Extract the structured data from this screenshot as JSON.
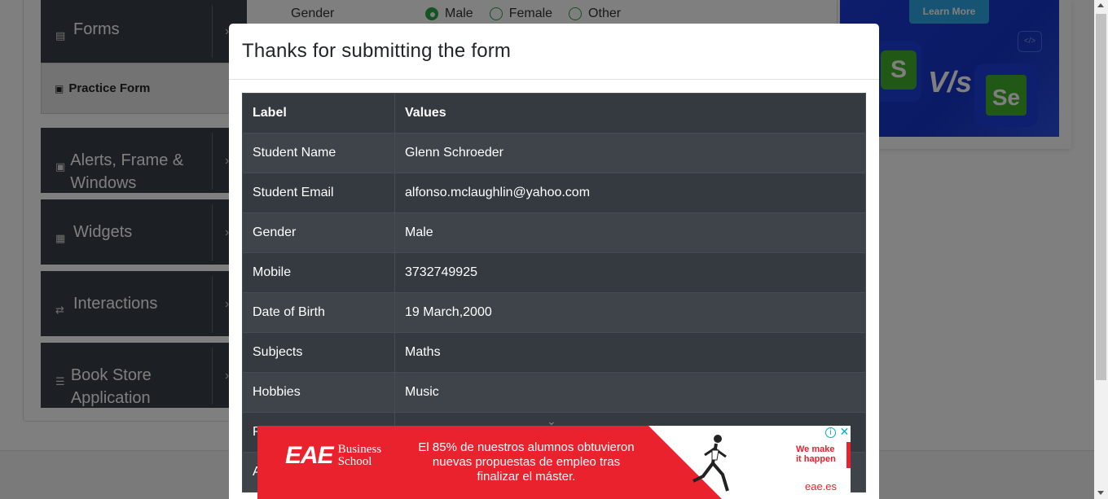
{
  "sidebar": {
    "groups": [
      {
        "label": "Forms",
        "icon": "document-icon"
      },
      {
        "label": "Alerts, Frame & Windows",
        "icon": "window-icon"
      },
      {
        "label": "Widgets",
        "icon": "widgets-icon"
      },
      {
        "label": "Interactions",
        "icon": "interactions-icon"
      },
      {
        "label": "Book Store Application",
        "icon": "books-icon"
      }
    ],
    "practice_form": "Practice Form"
  },
  "form": {
    "gender_label": "Gender",
    "gender_options": [
      "Male",
      "Female",
      "Other"
    ],
    "selected": "Male"
  },
  "top_ad": {
    "learn_more": "Learn More",
    "vs": "V/s",
    "se": "Se"
  },
  "modal": {
    "title": "Thanks for submitting the form",
    "headers": [
      "Label",
      "Values"
    ],
    "rows": [
      [
        "Student Name",
        "Glenn Schroeder"
      ],
      [
        "Student Email",
        "alfonso.mclaughlin@yahoo.com"
      ],
      [
        "Gender",
        "Male"
      ],
      [
        "Mobile",
        "3732749925"
      ],
      [
        "Date of Birth",
        "19 March,2000"
      ],
      [
        "Subjects",
        "Maths"
      ],
      [
        "Hobbies",
        "Music"
      ],
      [
        "P",
        ""
      ],
      [
        "A",
        ""
      ]
    ]
  },
  "bottom_ad": {
    "brand_main": "EAE",
    "brand_line1": "Business",
    "brand_line2": "School",
    "text": "El 85% de nuestros alumnos obtuvieron nuevas propuestas de empleo tras finalizar el máster.",
    "slogan_line1": "We make",
    "slogan_line2": "it happen",
    "url": "eae.es",
    "info": "i",
    "close": "✕"
  },
  "colors": {
    "sidebar_bg": "#393e46",
    "accent_green": "#28a745",
    "table_dark": "#343a40",
    "ad_red": "#e9222e"
  }
}
